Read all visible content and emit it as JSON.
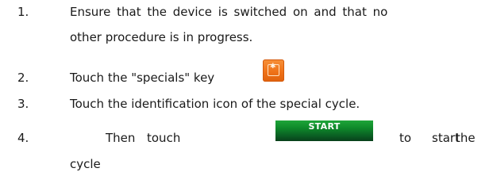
{
  "steps": [
    {
      "number": "1.",
      "lines": [
        "Ensure that the device is switched on and that no",
        "other procedure is in progress."
      ]
    },
    {
      "number": "2.",
      "text": "Touch the \"specials\" key",
      "icon": "specials-key-icon"
    },
    {
      "number": "3.",
      "text": "Touch the identification icon of the special cycle."
    },
    {
      "number": "4.",
      "words": [
        "Then",
        "touch",
        "to",
        "start",
        "the"
      ],
      "button_label": "START",
      "continuation": "cycle"
    }
  ],
  "colors": {
    "specials_icon": "#ef7218",
    "start_button": "#0f7a2b",
    "text": "#1a1a1a"
  }
}
